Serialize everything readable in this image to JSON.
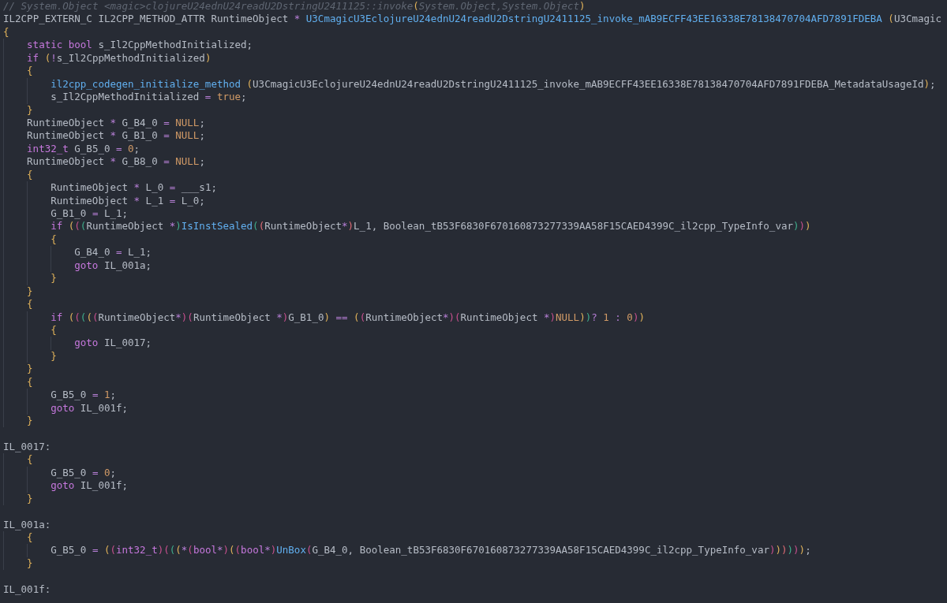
{
  "editor": {
    "lines": [
      {
        "kind": "code",
        "tokens": [
          {
            "kind": "comment",
            "text": "// System.Object <magic>clojureU24ednU24readU2DstringU2411125::invoke"
          },
          {
            "kind": "paren1",
            "text": "("
          },
          {
            "kind": "comment",
            "text": "System.Object,System.Object"
          },
          {
            "kind": "paren1",
            "text": ")"
          }
        ]
      },
      {
        "kind": "code",
        "tokens": [
          {
            "kind": "plain",
            "text": "IL2CPP_EXTERN_C IL2CPP_METHOD_ATTR RuntimeObject "
          },
          {
            "kind": "operator",
            "text": "*"
          },
          {
            "kind": "call",
            "text": " U3CmagicU3EclojureU24ednU24readU2DstringU2411125_invoke_mAB9ECFF43EE16338E78138470704AFD7891FDEBA"
          },
          {
            "kind": "paren1",
            "text": " ("
          },
          {
            "kind": "plain",
            "text": "U3Cmagic"
          }
        ]
      },
      {
        "kind": "code",
        "tokens": [
          {
            "kind": "paren1",
            "text": "{"
          }
        ]
      },
      {
        "kind": "code",
        "tokens": [
          {
            "kind": "keyword",
            "text": "    static"
          },
          {
            "kind": "keyword",
            "text": " bool"
          },
          {
            "kind": "plain",
            "text": " s_Il2CppMethodInitialized;"
          }
        ]
      },
      {
        "kind": "code",
        "tokens": [
          {
            "kind": "keyword",
            "text": "    if"
          },
          {
            "kind": "paren1",
            "text": " ("
          },
          {
            "kind": "operator",
            "text": "!"
          },
          {
            "kind": "plain",
            "text": "s_Il2CppMethodInitialized"
          },
          {
            "kind": "paren1",
            "text": ")"
          }
        ]
      },
      {
        "kind": "code",
        "tokens": [
          {
            "kind": "paren1",
            "text": "    {"
          }
        ]
      },
      {
        "kind": "code",
        "tokens": [
          {
            "kind": "call",
            "text": "        il2cpp_codegen_initialize_method"
          },
          {
            "kind": "paren1",
            "text": " ("
          },
          {
            "kind": "plain",
            "text": "U3CmagicU3EclojureU24ednU24readU2DstringU2411125_invoke_mAB9ECFF43EE16338E78138470704AFD7891FDEBA_MetadataUsageId"
          },
          {
            "kind": "paren1",
            "text": ")"
          },
          {
            "kind": "plain",
            "text": ";"
          }
        ]
      },
      {
        "kind": "code",
        "tokens": [
          {
            "kind": "plain",
            "text": "        s_Il2CppMethodInitialized "
          },
          {
            "kind": "operator",
            "text": "="
          },
          {
            "kind": "literal",
            "text": " true"
          },
          {
            "kind": "plain",
            "text": ";"
          }
        ]
      },
      {
        "kind": "code",
        "tokens": [
          {
            "kind": "paren1",
            "text": "    }"
          }
        ]
      },
      {
        "kind": "code",
        "tokens": [
          {
            "kind": "plain",
            "text": "    RuntimeObject "
          },
          {
            "kind": "operator",
            "text": "*"
          },
          {
            "kind": "plain",
            "text": " G_B4_0 "
          },
          {
            "kind": "operator",
            "text": "="
          },
          {
            "kind": "literal",
            "text": " NULL"
          },
          {
            "kind": "plain",
            "text": ";"
          }
        ]
      },
      {
        "kind": "code",
        "tokens": [
          {
            "kind": "plain",
            "text": "    RuntimeObject "
          },
          {
            "kind": "operator",
            "text": "*"
          },
          {
            "kind": "plain",
            "text": " G_B1_0 "
          },
          {
            "kind": "operator",
            "text": "="
          },
          {
            "kind": "literal",
            "text": " NULL"
          },
          {
            "kind": "plain",
            "text": ";"
          }
        ]
      },
      {
        "kind": "code",
        "tokens": [
          {
            "kind": "keyword",
            "text": "    int32_t"
          },
          {
            "kind": "plain",
            "text": " G_B5_0 "
          },
          {
            "kind": "operator",
            "text": "="
          },
          {
            "kind": "literal",
            "text": " 0"
          },
          {
            "kind": "plain",
            "text": ";"
          }
        ]
      },
      {
        "kind": "code",
        "tokens": [
          {
            "kind": "plain",
            "text": "    RuntimeObject "
          },
          {
            "kind": "operator",
            "text": "*"
          },
          {
            "kind": "plain",
            "text": " G_B8_0 "
          },
          {
            "kind": "operator",
            "text": "="
          },
          {
            "kind": "literal",
            "text": " NULL"
          },
          {
            "kind": "plain",
            "text": ";"
          }
        ]
      },
      {
        "kind": "code",
        "tokens": [
          {
            "kind": "paren1",
            "text": "    {"
          }
        ]
      },
      {
        "kind": "code",
        "tokens": [
          {
            "kind": "plain",
            "text": "        RuntimeObject "
          },
          {
            "kind": "operator",
            "text": "*"
          },
          {
            "kind": "plain",
            "text": " L_0 "
          },
          {
            "kind": "operator",
            "text": "="
          },
          {
            "kind": "plain",
            "text": " ___s1;"
          }
        ]
      },
      {
        "kind": "code",
        "tokens": [
          {
            "kind": "plain",
            "text": "        RuntimeObject "
          },
          {
            "kind": "operator",
            "text": "*"
          },
          {
            "kind": "plain",
            "text": " L_1 "
          },
          {
            "kind": "operator",
            "text": "="
          },
          {
            "kind": "plain",
            "text": " L_0;"
          }
        ]
      },
      {
        "kind": "code",
        "tokens": [
          {
            "kind": "plain",
            "text": "        G_B1_0 "
          },
          {
            "kind": "operator",
            "text": "="
          },
          {
            "kind": "plain",
            "text": " L_1;"
          }
        ]
      },
      {
        "kind": "code",
        "tokens": [
          {
            "kind": "keyword",
            "text": "        if"
          },
          {
            "kind": "paren1",
            "text": " ("
          },
          {
            "kind": "paren2",
            "text": "("
          },
          {
            "kind": "paren3",
            "text": "("
          },
          {
            "kind": "plain",
            "text": "RuntimeObject "
          },
          {
            "kind": "operator",
            "text": "*"
          },
          {
            "kind": "paren3",
            "text": ")"
          },
          {
            "kind": "call",
            "text": "IsInstSealed"
          },
          {
            "kind": "paren3",
            "text": "("
          },
          {
            "kind": "paren4",
            "text": "("
          },
          {
            "kind": "plain",
            "text": "RuntimeObject"
          },
          {
            "kind": "operator",
            "text": "*"
          },
          {
            "kind": "paren4",
            "text": ")"
          },
          {
            "kind": "plain",
            "text": "L_1, Boolean_tB53F6830F670160873277339AA58F15CAED4399C_il2cpp_TypeInfo_var"
          },
          {
            "kind": "paren3",
            "text": ")"
          },
          {
            "kind": "paren2",
            "text": ")"
          },
          {
            "kind": "paren1",
            "text": ")"
          }
        ]
      },
      {
        "kind": "code",
        "tokens": [
          {
            "kind": "paren1",
            "text": "        {"
          }
        ]
      },
      {
        "kind": "code",
        "tokens": [
          {
            "kind": "plain",
            "text": "            G_B4_0 "
          },
          {
            "kind": "operator",
            "text": "="
          },
          {
            "kind": "plain",
            "text": " L_1;"
          }
        ]
      },
      {
        "kind": "code",
        "tokens": [
          {
            "kind": "keyword",
            "text": "            goto"
          },
          {
            "kind": "plain",
            "text": " IL_001a;"
          }
        ]
      },
      {
        "kind": "code",
        "tokens": [
          {
            "kind": "paren1",
            "text": "        }"
          }
        ]
      },
      {
        "kind": "code",
        "tokens": [
          {
            "kind": "paren1",
            "text": "    }"
          }
        ]
      },
      {
        "kind": "code",
        "tokens": [
          {
            "kind": "paren1",
            "text": "    {"
          }
        ]
      },
      {
        "kind": "code",
        "tokens": [
          {
            "kind": "keyword",
            "text": "        if"
          },
          {
            "kind": "paren1",
            "text": " ("
          },
          {
            "kind": "paren2",
            "text": "("
          },
          {
            "kind": "paren3",
            "text": "("
          },
          {
            "kind": "paren1",
            "text": "("
          },
          {
            "kind": "paren2",
            "text": "("
          },
          {
            "kind": "plain",
            "text": "RuntimeObject"
          },
          {
            "kind": "operator",
            "text": "*"
          },
          {
            "kind": "paren2",
            "text": ")"
          },
          {
            "kind": "paren2",
            "text": "("
          },
          {
            "kind": "plain",
            "text": "RuntimeObject "
          },
          {
            "kind": "operator",
            "text": "*"
          },
          {
            "kind": "paren2",
            "text": ")"
          },
          {
            "kind": "plain",
            "text": "G_B1_0"
          },
          {
            "kind": "paren1",
            "text": ")"
          },
          {
            "kind": "operator",
            "text": " == "
          },
          {
            "kind": "paren1",
            "text": "("
          },
          {
            "kind": "paren2",
            "text": "("
          },
          {
            "kind": "plain",
            "text": "RuntimeObject"
          },
          {
            "kind": "operator",
            "text": "*"
          },
          {
            "kind": "paren2",
            "text": ")"
          },
          {
            "kind": "paren2",
            "text": "("
          },
          {
            "kind": "plain",
            "text": "RuntimeObject "
          },
          {
            "kind": "operator",
            "text": "*"
          },
          {
            "kind": "paren2",
            "text": ")"
          },
          {
            "kind": "literal",
            "text": "NULL"
          },
          {
            "kind": "paren1",
            "text": ")"
          },
          {
            "kind": "paren3",
            "text": ")"
          },
          {
            "kind": "operator",
            "text": "?"
          },
          {
            "kind": "literal",
            "text": " 1"
          },
          {
            "kind": "operator",
            "text": " :"
          },
          {
            "kind": "literal",
            "text": " 0"
          },
          {
            "kind": "paren2",
            "text": ")"
          },
          {
            "kind": "paren1",
            "text": ")"
          }
        ]
      },
      {
        "kind": "code",
        "tokens": [
          {
            "kind": "paren1",
            "text": "        {"
          }
        ]
      },
      {
        "kind": "code",
        "tokens": [
          {
            "kind": "keyword",
            "text": "            goto"
          },
          {
            "kind": "plain",
            "text": " IL_0017;"
          }
        ]
      },
      {
        "kind": "code",
        "tokens": [
          {
            "kind": "paren1",
            "text": "        }"
          }
        ]
      },
      {
        "kind": "code",
        "tokens": [
          {
            "kind": "paren1",
            "text": "    }"
          }
        ]
      },
      {
        "kind": "code",
        "tokens": [
          {
            "kind": "paren1",
            "text": "    {"
          }
        ]
      },
      {
        "kind": "code",
        "tokens": [
          {
            "kind": "plain",
            "text": "        G_B5_0 "
          },
          {
            "kind": "operator",
            "text": "="
          },
          {
            "kind": "literal",
            "text": " 1"
          },
          {
            "kind": "plain",
            "text": ";"
          }
        ]
      },
      {
        "kind": "code",
        "tokens": [
          {
            "kind": "keyword",
            "text": "        goto"
          },
          {
            "kind": "plain",
            "text": " IL_001f;"
          }
        ]
      },
      {
        "kind": "code",
        "tokens": [
          {
            "kind": "paren1",
            "text": "    }"
          }
        ]
      },
      {
        "kind": "blank"
      },
      {
        "kind": "code",
        "tokens": [
          {
            "kind": "plain",
            "text": "IL_0017:"
          }
        ]
      },
      {
        "kind": "code",
        "tokens": [
          {
            "kind": "paren1",
            "text": "    {"
          }
        ]
      },
      {
        "kind": "code",
        "tokens": [
          {
            "kind": "plain",
            "text": "        G_B5_0 "
          },
          {
            "kind": "operator",
            "text": "="
          },
          {
            "kind": "literal",
            "text": " 0"
          },
          {
            "kind": "plain",
            "text": ";"
          }
        ]
      },
      {
        "kind": "code",
        "tokens": [
          {
            "kind": "keyword",
            "text": "        goto"
          },
          {
            "kind": "plain",
            "text": " IL_001f;"
          }
        ]
      },
      {
        "kind": "code",
        "tokens": [
          {
            "kind": "paren1",
            "text": "    }"
          }
        ]
      },
      {
        "kind": "blank"
      },
      {
        "kind": "code",
        "tokens": [
          {
            "kind": "plain",
            "text": "IL_001a:"
          }
        ]
      },
      {
        "kind": "code",
        "tokens": [
          {
            "kind": "paren1",
            "text": "    {"
          }
        ]
      },
      {
        "kind": "code",
        "tokens": [
          {
            "kind": "plain",
            "text": "        G_B5_0 "
          },
          {
            "kind": "operator",
            "text": "="
          },
          {
            "kind": "paren1",
            "text": " ("
          },
          {
            "kind": "paren2",
            "text": "("
          },
          {
            "kind": "keyword",
            "text": "int32_t"
          },
          {
            "kind": "paren2",
            "text": ")"
          },
          {
            "kind": "paren2",
            "text": "("
          },
          {
            "kind": "paren3",
            "text": "("
          },
          {
            "kind": "paren1",
            "text": "("
          },
          {
            "kind": "operator",
            "text": "*"
          },
          {
            "kind": "paren2",
            "text": "("
          },
          {
            "kind": "keyword",
            "text": "bool"
          },
          {
            "kind": "operator",
            "text": "*"
          },
          {
            "kind": "paren2",
            "text": ")"
          },
          {
            "kind": "paren1",
            "text": "("
          },
          {
            "kind": "paren2",
            "text": "("
          },
          {
            "kind": "keyword",
            "text": "bool"
          },
          {
            "kind": "operator",
            "text": "*"
          },
          {
            "kind": "paren2",
            "text": ")"
          },
          {
            "kind": "call",
            "text": "UnBox"
          },
          {
            "kind": "paren2",
            "text": "("
          },
          {
            "kind": "plain",
            "text": "G_B4_0, Boolean_tB53F6830F670160873277339AA58F15CAED4399C_il2cpp_TypeInfo_var"
          },
          {
            "kind": "paren2",
            "text": ")"
          },
          {
            "kind": "paren1",
            "text": ")"
          },
          {
            "kind": "paren4",
            "text": ")"
          },
          {
            "kind": "paren3",
            "text": ")"
          },
          {
            "kind": "paren2",
            "text": ")"
          },
          {
            "kind": "paren1",
            "text": ")"
          },
          {
            "kind": "plain",
            "text": ";"
          }
        ]
      },
      {
        "kind": "code",
        "tokens": [
          {
            "kind": "paren1",
            "text": "    }"
          }
        ]
      },
      {
        "kind": "blank"
      },
      {
        "kind": "code",
        "tokens": [
          {
            "kind": "plain",
            "text": "IL_001f:"
          }
        ]
      }
    ]
  }
}
